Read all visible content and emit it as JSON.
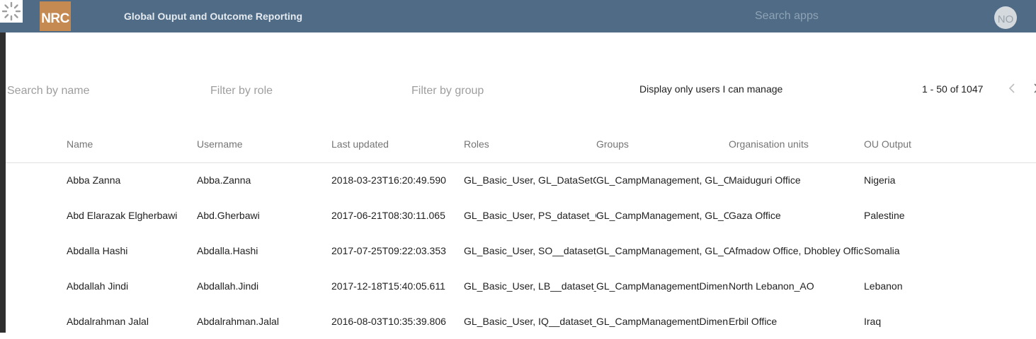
{
  "header": {
    "logo_text": "NRC",
    "app_title": "Global Ouput and Outcome Reporting",
    "search_placeholder": "Search apps",
    "profile_initials": "NO",
    "bg_color": "#4f6b85"
  },
  "filters": {
    "search_name_placeholder": "Search by name",
    "filter_role_placeholder": "Filter by role",
    "filter_group_placeholder": "Filter by group",
    "manage_label": "Display only users I can manage"
  },
  "pagination": {
    "label": "1 - 50 of 1047",
    "prev_icon": "chevron-left-icon",
    "next_icon": "chevron-right-icon"
  },
  "table": {
    "columns": [
      "Name",
      "Username",
      "Last updated",
      "Roles",
      "Groups",
      "Organisation units",
      "OU Output"
    ],
    "rows": [
      [
        "Abba Zanna",
        "Abba.Zanna",
        "2018-03-23T16:20:49.590",
        "GL_Basic_User, GL_DataSetCo",
        "GL_CampManagement, GL_Ca",
        "Maiduguri Office",
        "Nigeria"
      ],
      [
        "Abd Elarazak Elgherbawi",
        "Abd.Gherbawi",
        "2017-06-21T08:30:11.065",
        "GL_Basic_User, PS_dataset_Cl",
        "GL_CampManagement, GL_Ca",
        "Gaza Office",
        "Palestine"
      ],
      [
        "Abdalla Hashi",
        "Abdalla.Hashi",
        "2017-07-25T09:22:03.353",
        "GL_Basic_User, SO__dataset_e",
        "GL_CampManagement, GL_Ca",
        "Afmadow Office, Dhobley Office",
        "Somalia"
      ],
      [
        "Abdallah Jindi",
        "Abdallah.Jindi",
        "2017-12-18T15:40:05.611",
        "GL_Basic_User, LB__dataset_e",
        "GL_CampManagementDimens",
        "North Lebanon_AO",
        "Lebanon"
      ],
      [
        "Abdalrahman Jalal",
        "Abdalrahman.Jalal",
        "2016-08-03T10:35:39.806",
        "GL_Basic_User, IQ__dataset_c",
        "GL_CampManagementDimens",
        "Erbil Office",
        "Iraq"
      ]
    ]
  }
}
